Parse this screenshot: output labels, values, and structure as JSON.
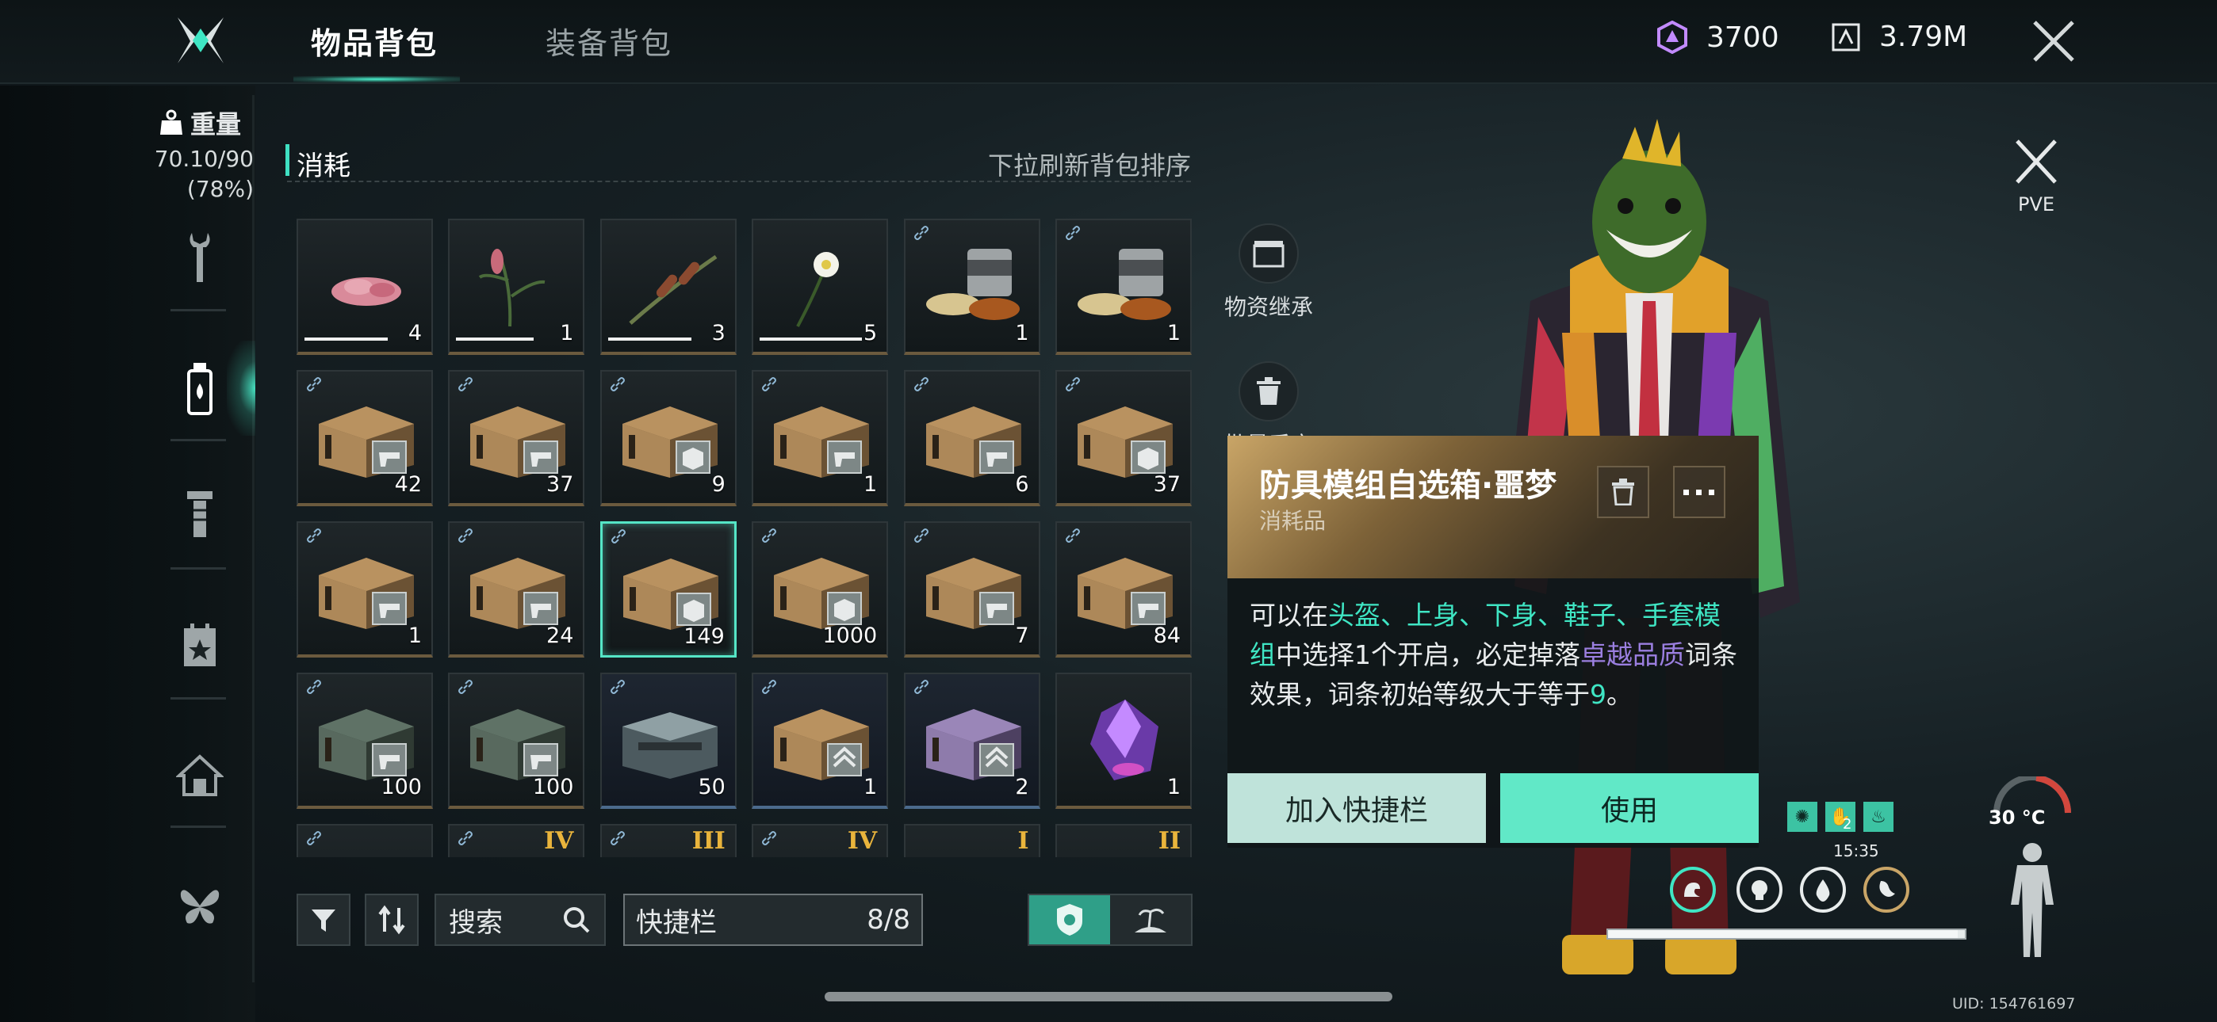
{
  "topbar": {
    "tabs": [
      {
        "label": "物品背包",
        "active": true
      },
      {
        "label": "装备背包",
        "active": false
      }
    ],
    "currency_1": {
      "icon": "hexagon-gem-icon",
      "value": "3700",
      "color": "#c28bff"
    },
    "currency_2": {
      "icon": "chip-icon",
      "value": "3.79M"
    },
    "close_icon": "close-icon"
  },
  "sidebar": {
    "weight_title": "重量",
    "weight_value": "70.10/90",
    "weight_percent": "(78%)",
    "items": [
      {
        "icon": "wrench-icon",
        "active": false
      },
      {
        "icon": "bottle-icon",
        "active": true
      },
      {
        "icon": "bolt-icon",
        "active": false
      },
      {
        "icon": "calendar-star-icon",
        "active": false
      },
      {
        "icon": "house-icon",
        "active": false
      },
      {
        "icon": "butterfly-icon",
        "active": false
      }
    ]
  },
  "section": {
    "title": "消耗",
    "hint": "下拉刷新背包排序"
  },
  "grid": {
    "rows": [
      [
        {
          "item": "raw-meat",
          "qty": "4",
          "durability": 0.75
        },
        {
          "item": "herb-plant",
          "qty": "1",
          "durability": 0.7
        },
        {
          "item": "cattail-plant",
          "qty": "3",
          "durability": 0.75
        },
        {
          "item": "white-flower",
          "qty": "5",
          "durability": 0.92
        },
        {
          "item": "canned-food",
          "qty": "1",
          "linked": true
        },
        {
          "item": "canned-food",
          "qty": "1",
          "linked": true
        }
      ],
      [
        {
          "item": "weapon-crate",
          "qty": "42",
          "linked": true
        },
        {
          "item": "weapon-crate",
          "qty": "37",
          "linked": true
        },
        {
          "item": "armor-crate",
          "qty": "9",
          "linked": true
        },
        {
          "item": "weapon-crate",
          "qty": "1",
          "linked": true
        },
        {
          "item": "weapon-crate",
          "qty": "6",
          "linked": true
        },
        {
          "item": "armor-crate",
          "qty": "37",
          "linked": true
        }
      ],
      [
        {
          "item": "weapon-crate",
          "qty": "1",
          "linked": true
        },
        {
          "item": "weapon-crate",
          "qty": "24",
          "linked": true
        },
        {
          "item": "armor-crate",
          "qty": "149",
          "linked": true,
          "selected": true
        },
        {
          "item": "armor-crate",
          "qty": "1000",
          "linked": true
        },
        {
          "item": "weapon-crate",
          "qty": "7",
          "linked": true
        },
        {
          "item": "weapon-crate",
          "qty": "84",
          "linked": true
        }
      ],
      [
        {
          "item": "green-crate",
          "qty": "100",
          "linked": true
        },
        {
          "item": "green-crate",
          "qty": "100",
          "linked": true
        },
        {
          "item": "steel-crate",
          "qty": "50",
          "linked": true,
          "rarity": "blue"
        },
        {
          "item": "rank-crate",
          "qty": "1",
          "linked": true,
          "rarity": "blue"
        },
        {
          "item": "purple-rank-crate",
          "qty": "2",
          "linked": true,
          "rarity": "blue"
        },
        {
          "item": "purple-crystal",
          "qty": "1"
        }
      ],
      [
        {
          "tier": "",
          "linked": true
        },
        {
          "tier": "IV",
          "linked": true
        },
        {
          "tier": "III",
          "linked": true
        },
        {
          "tier": "IV",
          "linked": true
        },
        {
          "tier": "I"
        },
        {
          "tier": "II"
        }
      ]
    ]
  },
  "controls": {
    "filter_icon": "filter-icon",
    "sort_icon": "sort-icon",
    "search_label": "搜索",
    "hotbar_label": "快捷栏",
    "hotbar_count": "8/8",
    "toggle": [
      "badge-icon",
      "island-icon"
    ]
  },
  "side_actions": {
    "inherit_label": "物资继承",
    "discard_label": "批量丢弃"
  },
  "tooltip": {
    "title": "防具模组自选箱·噩梦",
    "subtitle": "消耗品",
    "desc_1": "可以在",
    "desc_green_1": "头盔、上身、下身、鞋子、手套模组",
    "desc_2": "中选择1个开启，必定掉落",
    "desc_purple": "卓越品质",
    "desc_3": "词条效果，词条初始等级大于等于",
    "desc_green_2": "9",
    "desc_4": "。",
    "add_hotbar": "加入快捷栏",
    "use": "使用"
  },
  "hud": {
    "mode": "PVE",
    "temperature": "30 °C",
    "time": "15:35",
    "buff_count": "2",
    "uid": "UID: 154761697",
    "health_fraction": 0.98,
    "status_icons": [
      "arm-strength-icon",
      "head-icon",
      "water-drop-icon",
      "stomach-icon"
    ],
    "buff_icons": [
      "virus-icon",
      "shield-hand-icon",
      "fire-icon"
    ]
  }
}
